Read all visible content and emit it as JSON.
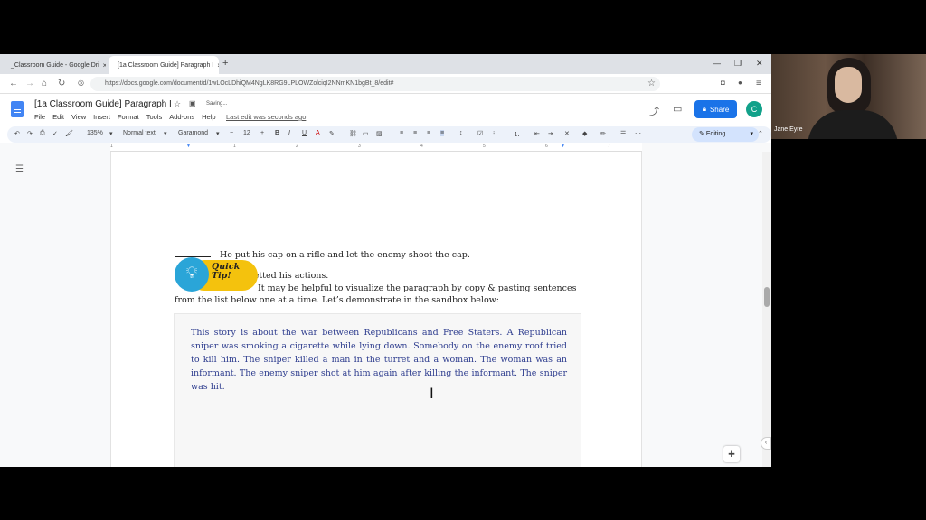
{
  "browser": {
    "tabs": [
      {
        "label": "_Classroom Guide - Google Dri",
        "close": "×"
      },
      {
        "label": "[1a Classroom Guide] Paragraph I",
        "close": "×"
      }
    ],
    "new_tab": "+",
    "window_controls": [
      "—",
      "❐",
      "✕"
    ],
    "url": "https://docs.google.com/document/d/1wLOcLDhiQM4NgLK8RG9LPLOWZolciqI2NNmKN1bgBt_8/edit#"
  },
  "docs": {
    "title": "[1a Classroom Guide] Paragraph I",
    "status": "Saving...",
    "menu": [
      "File",
      "Edit",
      "View",
      "Insert",
      "Format",
      "Tools",
      "Add-ons",
      "Help"
    ],
    "last_edit": "Last edit was seconds ago",
    "share_label": "Share",
    "avatar_letter": "C"
  },
  "toolbar": {
    "zoom": "135%",
    "style": "Normal text",
    "font": "Garamond",
    "font_size": "12",
    "mode": "Editing"
  },
  "ruler": [
    "1",
    "1",
    "2",
    "3",
    "4",
    "5",
    "6",
    "7"
  ],
  "document": {
    "line1": "He put his cap on a rifle and let the enemy shoot the cap.",
    "line2": "He regretted his actions.",
    "quick_tip": "Quick Tip!",
    "tip_text": "It may be helpful to visualize the paragraph by copy & pasting sentences from the list below one at a time. Let’s demonstrate in the sandbox below:",
    "sandbox_text": "This story is about the war between Republicans and Free Staters. A Republican sniper was smoking a cigarette while lying down. Somebody on the enemy roof tried to kill him. The sniper killed a man in the turret and a woman. The woman was an informant. The enemy sniper shot at him again after killing the informant. The sniper was hit."
  },
  "webcam": {
    "name": "Jane Eyre"
  },
  "colors": {
    "share_blue": "#1a73e8",
    "sandbox_text": "#2d3c8e",
    "tip_yellow": "#f4c20d",
    "bulb_blue": "#2aa5d8"
  }
}
